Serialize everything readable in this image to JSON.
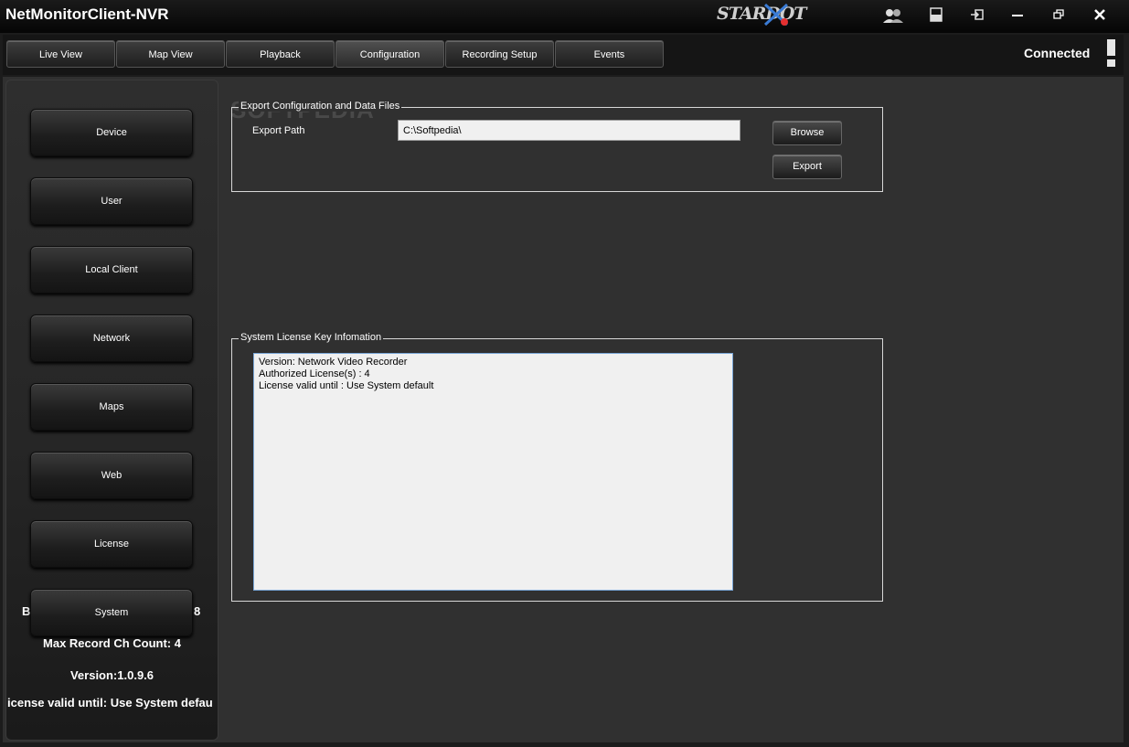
{
  "app": {
    "title": "NetMonitorClient-NVR",
    "logo": "STARDOT"
  },
  "window_controls": [
    "users-icon",
    "layout-icon",
    "logout-icon",
    "minimize-icon",
    "restore-icon",
    "close-icon"
  ],
  "tabs": [
    {
      "label": "Live View"
    },
    {
      "label": "Map View"
    },
    {
      "label": "Playback"
    },
    {
      "label": "Configuration",
      "active": true
    },
    {
      "label": "Recording Setup"
    },
    {
      "label": "Events"
    }
  ],
  "status": {
    "text": "Connected"
  },
  "sidebar": {
    "items": [
      {
        "label": "Device"
      },
      {
        "label": "User"
      },
      {
        "label": "Local Client"
      },
      {
        "label": "Network"
      },
      {
        "label": "Maps"
      },
      {
        "label": "Web"
      },
      {
        "label": "License"
      },
      {
        "label": "System"
      }
    ],
    "info_partial_left": "B",
    "info_partial_right": "8",
    "max_record": "Max Record Ch Count: 4",
    "version": "Version:1.0.9.6",
    "license_valid": "icense valid until: Use System defau"
  },
  "export_group": {
    "legend": "Export Configuration and Data Files",
    "path_label": "Export Path",
    "path_value": "C:\\Softpedia\\",
    "browse_label": "Browse",
    "export_label": "Export"
  },
  "license_group": {
    "legend": "System License Key Infomation",
    "lines": [
      "Version: Network Video Recorder",
      "Authorized License(s) : 4",
      "License valid until : Use System default"
    ]
  },
  "watermark": "SOFTPEDIA"
}
